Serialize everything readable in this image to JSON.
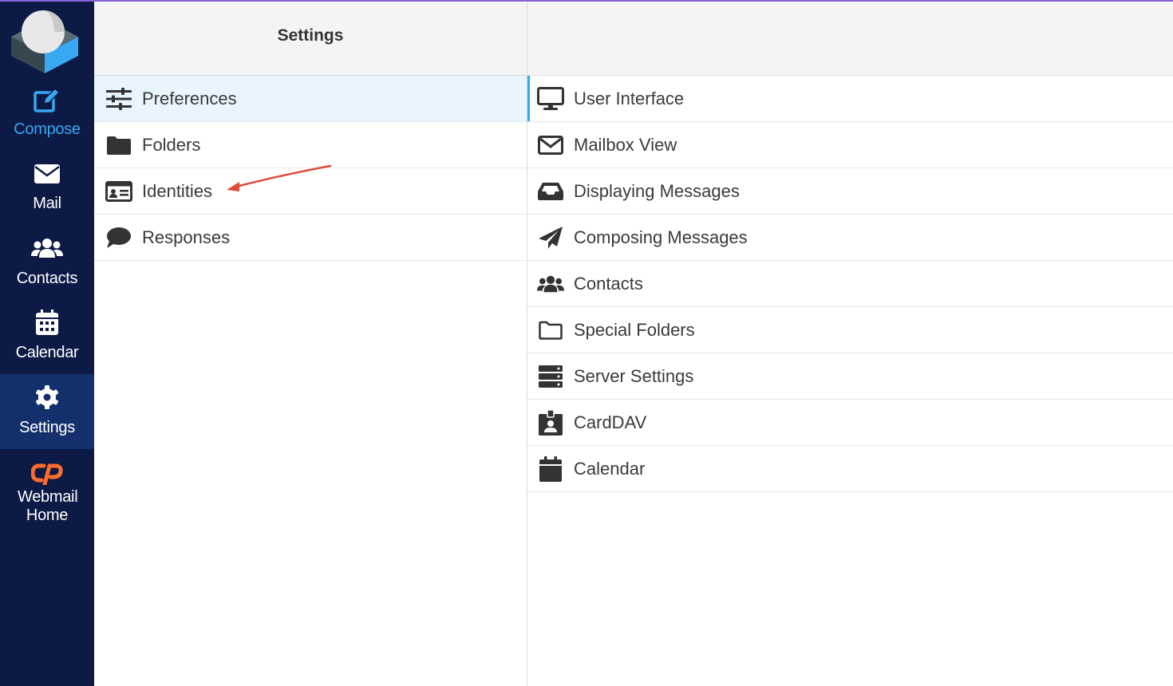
{
  "colors": {
    "sidebar_bg": "#0c1a45",
    "sidebar_active": "#14306c",
    "accent": "#37a8f2",
    "selected_row": "#e9f5fd",
    "annotation_arrow": "#e04a3a",
    "cpanel": "#ff6c2c"
  },
  "sidebar": {
    "items": [
      {
        "label": "Compose",
        "icon": "compose-icon"
      },
      {
        "label": "Mail",
        "icon": "envelope-icon"
      },
      {
        "label": "Contacts",
        "icon": "users-icon"
      },
      {
        "label": "Calendar",
        "icon": "calendar-icon"
      },
      {
        "label": "Settings",
        "icon": "gear-icon",
        "active": true
      },
      {
        "label": "Webmail Home",
        "icon": "cpanel-icon"
      }
    ]
  },
  "settings_panel": {
    "title": "Settings",
    "items": [
      {
        "label": "Preferences",
        "icon": "sliders-icon",
        "selected": true
      },
      {
        "label": "Folders",
        "icon": "folder-icon"
      },
      {
        "label": "Identities",
        "icon": "id-card-icon"
      },
      {
        "label": "Responses",
        "icon": "comment-icon"
      }
    ]
  },
  "preferences_panel": {
    "items": [
      {
        "label": "User Interface",
        "icon": "monitor-icon",
        "selected": true
      },
      {
        "label": "Mailbox View",
        "icon": "envelope-outline-icon"
      },
      {
        "label": "Displaying Messages",
        "icon": "inbox-icon"
      },
      {
        "label": "Composing Messages",
        "icon": "paper-plane-icon"
      },
      {
        "label": "Contacts",
        "icon": "users-icon"
      },
      {
        "label": "Special Folders",
        "icon": "folder-outline-icon"
      },
      {
        "label": "Server Settings",
        "icon": "server-icon"
      },
      {
        "label": "CardDAV",
        "icon": "address-card-icon"
      },
      {
        "label": "Calendar",
        "icon": "calendar-icon"
      }
    ]
  }
}
